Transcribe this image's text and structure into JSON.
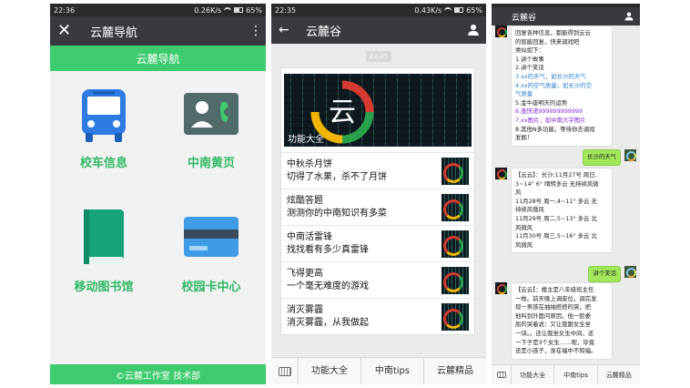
{
  "phone1": {
    "status": {
      "time": "22:36",
      "speed": "0.26K/s",
      "battery": "65%"
    },
    "title": "云麓导航",
    "banner": "云麓导航",
    "tiles": [
      {
        "label": "校车信息",
        "icon": "bus-icon"
      },
      {
        "label": "中南黄页",
        "icon": "contact-phone-icon"
      },
      {
        "label": "移动图书馆",
        "icon": "book-icon"
      },
      {
        "label": "校园卡中心",
        "icon": "card-icon"
      }
    ],
    "footer": "©云麓工作室 技术部",
    "colors": {
      "accent": "#3ecb6e",
      "tile_text": "#2fb864"
    }
  },
  "phone2": {
    "status": {
      "time": "22:35",
      "speed": "0.43K/s",
      "battery": "65%"
    },
    "title": "云麓谷",
    "time_chip": "22:35",
    "banner_caption": "功能大全",
    "banner_logo_char": "云",
    "items": [
      {
        "line1": "中秋杀月饼",
        "line2": "切得了水果，杀不了月饼"
      },
      {
        "line1": "炫酷答题",
        "line2": "测测你的中南知识有多菜"
      },
      {
        "line1": "中南活雷锋",
        "line2": "找找看有多少真雷锋"
      },
      {
        "line1": "飞得更高",
        "line2": "一个毫无难度的游戏"
      },
      {
        "line1": "消灭雾霾",
        "line2": "消灭雾霾，从我做起"
      }
    ],
    "menu": [
      "功能大全",
      "中南tips",
      "云麓精品"
    ]
  },
  "phone3": {
    "title": "云麓谷",
    "messages": {
      "m1": [
        "回复各种信息，都能得到云云",
        "的智能回复，快来调戏吧",
        "类似如下：",
        "1.讲个故事",
        "2.讲个笑话",
        "3.xx的天气，如长沙的天气",
        "4.xx的空气质量，如长沙的空",
        "气质量",
        "5.金牛座明天的运势",
        "6.查快递999999999999",
        "7.xx图片，如中南大学图片",
        "8.其他N多功能，等待你去调戏",
        "发掘！"
      ],
      "u1": "长沙的天气",
      "m2": [
        "【云云】：长沙:11月27号 周日,",
        "3~14° 6° 晴转多云 无持续风微",
        "风",
        "11月28号 周一,4~11° 多云 无",
        "持续风微风",
        "11月29号 周二,5~13° 多云 北",
        "风微风",
        "11月30号 周三,5~16° 多云 北",
        "风微风"
      ],
      "u2": "讲个笑话",
      "m3": [
        "【云云】：楼主是八年级班主任",
        "一枚。前天晚上调座位，调完发",
        "现一男孩在抽抽搭搭的哭，把",
        "他叫到外面问原因，他一脸委",
        "屈的哭着说：又让我跟女生坐",
        "一块。。还让我坐女生中间，还",
        "一下子是3个女生……呢，毕竟",
        "还是小孩子，身在福中不知福。"
      ]
    },
    "menu": [
      "功能大全",
      "中南tips",
      "云麓精品"
    ]
  }
}
